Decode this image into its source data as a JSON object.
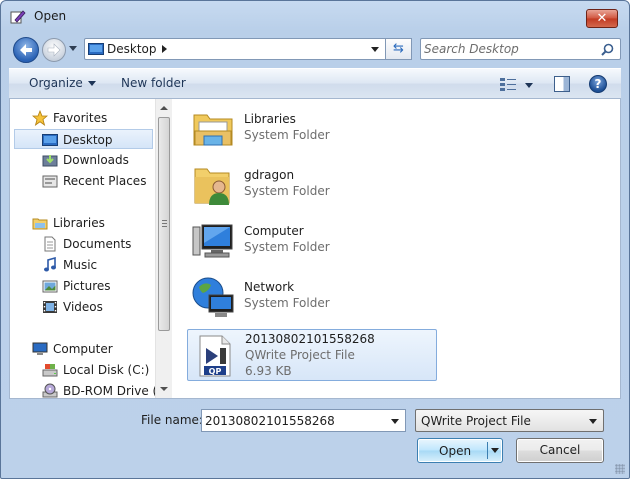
{
  "window": {
    "title": "Open"
  },
  "address": {
    "location": "Desktop"
  },
  "search": {
    "placeholder": "Search Desktop"
  },
  "toolbar": {
    "organize_label": "Organize",
    "new_folder_label": "New folder",
    "help_label": "?"
  },
  "nav": {
    "favorites": "Favorites",
    "desktop": "Desktop",
    "downloads": "Downloads",
    "recent_places": "Recent Places",
    "libraries": "Libraries",
    "documents": "Documents",
    "music": "Music",
    "pictures": "Pictures",
    "videos": "Videos",
    "computer": "Computer",
    "local_disk": "Local Disk (C:)",
    "bd_rom": "BD-ROM Drive (D"
  },
  "files": [
    {
      "name": "Libraries",
      "type": "System Folder"
    },
    {
      "name": "gdragon",
      "type": "System Folder"
    },
    {
      "name": "Computer",
      "type": "System Folder"
    },
    {
      "name": "Network",
      "type": "System Folder"
    },
    {
      "name": "20130802101558268",
      "type": "QWrite Project File",
      "size": "6.93 KB",
      "badge": "QP"
    }
  ],
  "bottom": {
    "filename_label": "File name:",
    "filename_value": "20130802101558268",
    "filetype_value": "QWrite Project File",
    "open_label": "Open",
    "cancel_label": "Cancel"
  }
}
